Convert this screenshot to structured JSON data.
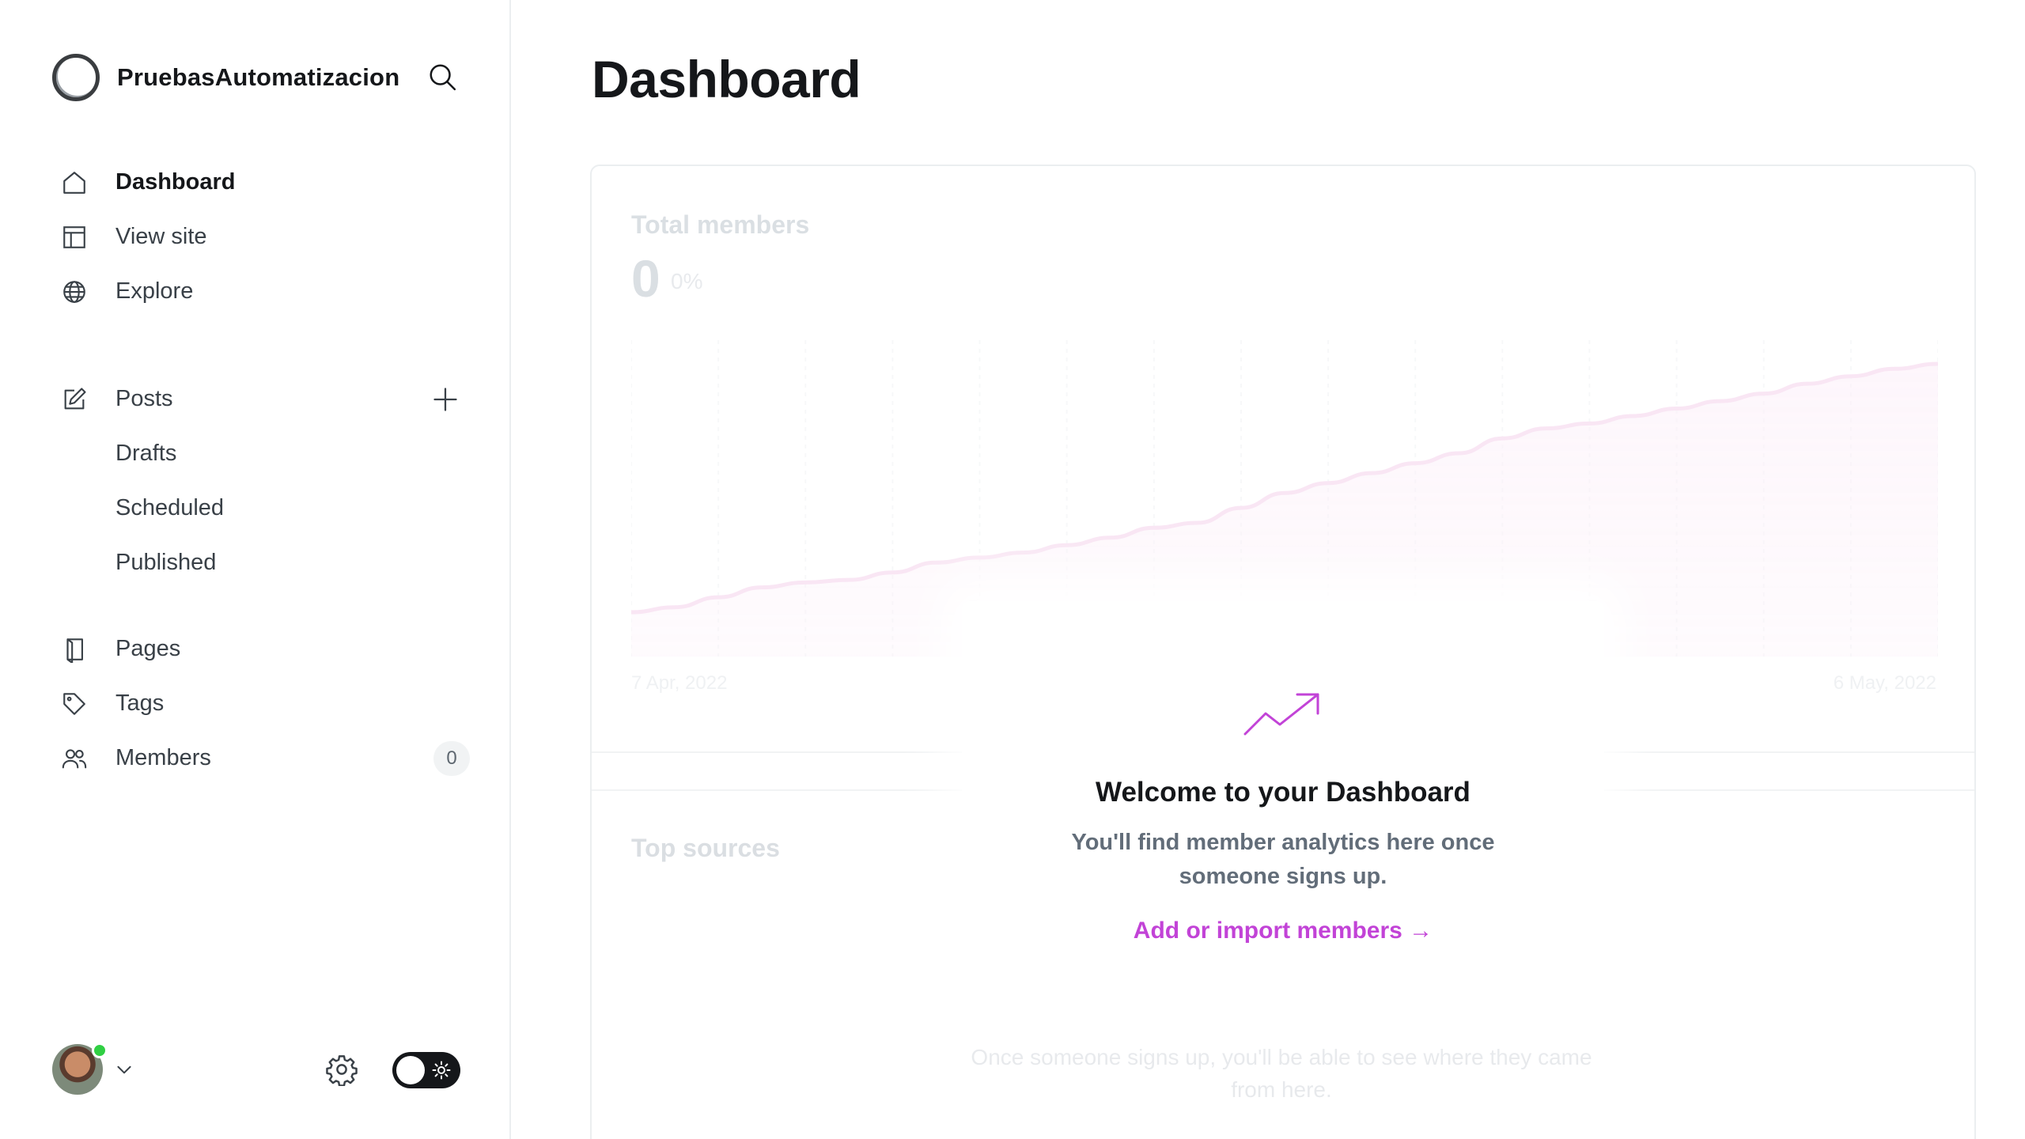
{
  "sidebar": {
    "site_name": "PruebasAutomatizacion",
    "nav_main": [
      {
        "label": "Dashboard",
        "icon": "home-icon",
        "active": true
      },
      {
        "label": "View site",
        "icon": "layout-icon"
      },
      {
        "label": "Explore",
        "icon": "globe-icon"
      }
    ],
    "posts": {
      "label": "Posts",
      "icon": "edit-icon",
      "sub": [
        "Drafts",
        "Scheduled",
        "Published"
      ]
    },
    "nav_secondary": [
      {
        "label": "Pages",
        "icon": "pages-icon"
      },
      {
        "label": "Tags",
        "icon": "tag-icon"
      },
      {
        "label": "Members",
        "icon": "members-icon",
        "count": "0"
      }
    ]
  },
  "main": {
    "title": "Dashboard",
    "members_card": {
      "label": "Total members",
      "value": "0",
      "change": "0%",
      "date_start": "7 Apr, 2022",
      "date_end": "6 May, 2022"
    },
    "top_sources": {
      "label": "Top sources",
      "empty_text": "Once someone signs up, you'll be able to see where they came from here."
    },
    "welcome": {
      "title": "Welcome to your Dashboard",
      "text": "You'll find member analytics here once someone signs up.",
      "link": "Add or import members →"
    }
  },
  "chart_data": {
    "type": "area",
    "series": [
      {
        "values": [
          0,
          2,
          6,
          10,
          12,
          13,
          16,
          20,
          22,
          24,
          27,
          30,
          34,
          36,
          42,
          48,
          52,
          56,
          60,
          64,
          70,
          74,
          76,
          79,
          82,
          85,
          88,
          92,
          95,
          98,
          100
        ]
      }
    ],
    "x_range": [
      "7 Apr, 2022",
      "6 May, 2022"
    ],
    "grid": "vertical dashed",
    "color": "#e9a6d8"
  },
  "colors": {
    "accent": "#c243d7",
    "text_primary": "#15171a",
    "border": "#ebeef0"
  }
}
